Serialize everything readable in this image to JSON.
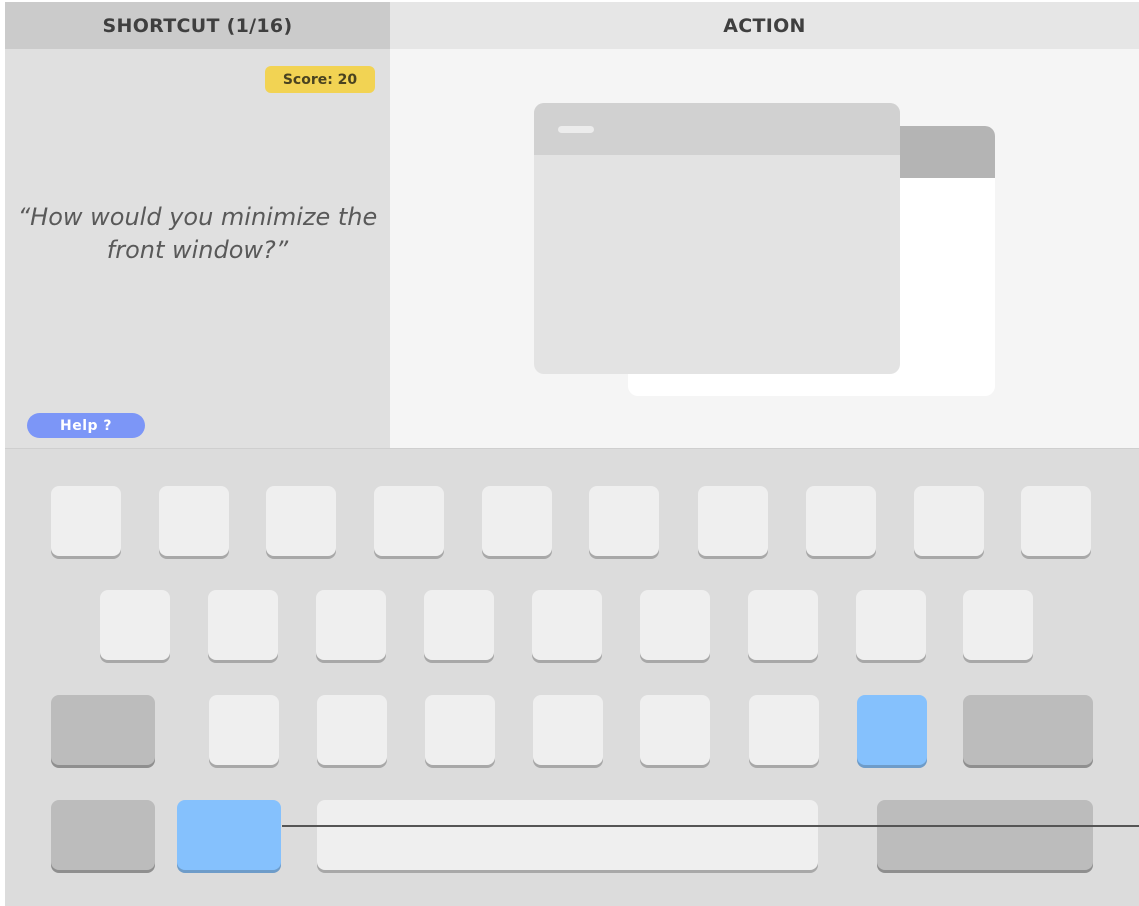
{
  "header": {
    "shortcut_label": "SHORTCUT (1/16)",
    "action_label": "ACTION"
  },
  "question": {
    "score": "Score: 20",
    "text": "“How would you minimize the front window?”",
    "help_label": "Help ?"
  },
  "action": {
    "illustration": "two overlapping windows, front window to be minimized"
  },
  "keyboard": {
    "highlighted_keys": [
      "command-left",
      "m-key"
    ],
    "accent_color": "#85c1fd"
  },
  "colors": {
    "score_badge": "#f2d353",
    "help_button": "#7c96f7"
  }
}
